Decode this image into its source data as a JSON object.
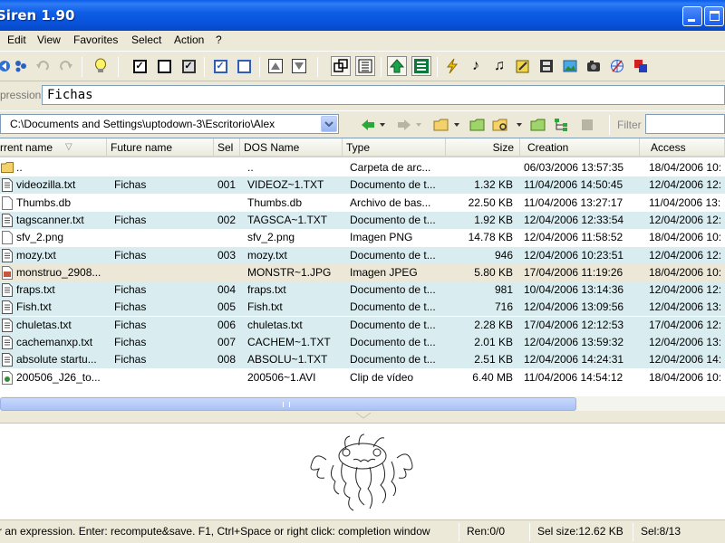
{
  "window": {
    "title": "Siren 1.90"
  },
  "menu": [
    "Edit",
    "View",
    "Favorites",
    "Select",
    "Action",
    "?"
  ],
  "toolbar": {
    "buttons": [
      "back-icon",
      "options-icon",
      "undo-icon",
      "redo-icon",
      "lightbulb-icon",
      "check-all-icon",
      "uncheck-all-icon",
      "invert-check-icon",
      "select-checked-icon",
      "deselect-icon",
      "move-up-icon",
      "move-down-icon",
      "recompute-icon",
      "text-view-icon",
      "apply-icon",
      "list-icon",
      "lightning-icon",
      "music-note-icon",
      "music-notes-icon",
      "edit-icon",
      "film-icon",
      "image-icon",
      "camera-icon",
      "globe-icon",
      "palette-icon"
    ]
  },
  "expression": {
    "label": "pression",
    "value": "Fichas"
  },
  "path": {
    "value": "C:\\Documents and Settings\\uptodown-3\\Escritorio\\Alex",
    "filter_label": "Filter",
    "filter_value": ""
  },
  "columns": {
    "current": "rrent name",
    "future": "Future name",
    "sel": "Sel",
    "dos": "DOS Name",
    "type": "Type",
    "size": "Size",
    "creation": "Creation",
    "access": "Access"
  },
  "rows": [
    {
      "icon": "folder-icon",
      "current": "..",
      "future": "",
      "sel": "",
      "dos": "..",
      "type": "Carpeta de arc...",
      "size": "",
      "creation": "06/03/2006 13:57:35",
      "access": "18/04/2006 10:",
      "tint": "none"
    },
    {
      "icon": "text-file-icon",
      "current": "videozilla.txt",
      "future": "Fichas",
      "sel": "001",
      "dos": "VIDEOZ~1.TXT",
      "type": "Documento de t...",
      "size": "1.32 KB",
      "creation": "11/04/2006 14:50:45",
      "access": "12/04/2006 12:",
      "tint": "blue"
    },
    {
      "icon": "blank-file-icon",
      "current": "Thumbs.db",
      "future": "",
      "sel": "",
      "dos": "Thumbs.db",
      "type": "Archivo de bas...",
      "size": "22.50 KB",
      "creation": "11/04/2006 13:27:17",
      "access": "11/04/2006 13:",
      "tint": "none"
    },
    {
      "icon": "text-file-icon",
      "current": "tagscanner.txt",
      "future": "Fichas",
      "sel": "002",
      "dos": "TAGSCA~1.TXT",
      "type": "Documento de t...",
      "size": "1.92 KB",
      "creation": "12/04/2006 12:33:54",
      "access": "12/04/2006 12:",
      "tint": "blue"
    },
    {
      "icon": "blank-file-icon",
      "current": "sfv_2.png",
      "future": "",
      "sel": "",
      "dos": "sfv_2.png",
      "type": "Imagen PNG",
      "size": "14.78 KB",
      "creation": "12/04/2006 11:58:52",
      "access": "18/04/2006 10:",
      "tint": "none"
    },
    {
      "icon": "text-file-icon",
      "current": "mozy.txt",
      "future": "Fichas",
      "sel": "003",
      "dos": "mozy.txt",
      "type": "Documento de t...",
      "size": "946",
      "creation": "12/04/2006 10:23:51",
      "access": "12/04/2006 12:",
      "tint": "blue"
    },
    {
      "icon": "image-file-icon",
      "current": "monstruo_2908...",
      "future": "",
      "sel": "",
      "dos": "MONSTR~1.JPG",
      "type": "Imagen JPEG",
      "size": "5.80 KB",
      "creation": "17/04/2006 11:19:26",
      "access": "18/04/2006 10:",
      "tint": "tan"
    },
    {
      "icon": "text-file-icon",
      "current": "fraps.txt",
      "future": "Fichas",
      "sel": "004",
      "dos": "fraps.txt",
      "type": "Documento de t...",
      "size": "981",
      "creation": "10/04/2006 13:14:36",
      "access": "12/04/2006 12:",
      "tint": "blue"
    },
    {
      "icon": "text-file-icon",
      "current": "Fish.txt",
      "future": "Fichas",
      "sel": "005",
      "dos": "Fish.txt",
      "type": "Documento de t...",
      "size": "716",
      "creation": "12/04/2006 13:09:56",
      "access": "12/04/2006 13:",
      "tint": "blue"
    },
    {
      "icon": "text-file-icon",
      "current": "chuletas.txt",
      "future": "Fichas",
      "sel": "006",
      "dos": "chuletas.txt",
      "type": "Documento de t...",
      "size": "2.28 KB",
      "creation": "17/04/2006 12:12:53",
      "access": "17/04/2006 12:",
      "tint": "blue"
    },
    {
      "icon": "text-file-icon",
      "current": "cachemanxp.txt",
      "future": "Fichas",
      "sel": "007",
      "dos": "CACHEM~1.TXT",
      "type": "Documento de t...",
      "size": "2.01 KB",
      "creation": "12/04/2006 13:59:32",
      "access": "12/04/2006 13:",
      "tint": "blue"
    },
    {
      "icon": "text-file-icon",
      "current": "absolute startu...",
      "future": "Fichas",
      "sel": "008",
      "dos": "ABSOLU~1.TXT",
      "type": "Documento de t...",
      "size": "2.51 KB",
      "creation": "12/04/2006 14:24:31",
      "access": "12/04/2006 14:",
      "tint": "blue"
    },
    {
      "icon": "video-file-icon",
      "current": "200506_J26_to...",
      "future": "",
      "sel": "",
      "dos": "200506~1.AVI",
      "type": "Clip de vídeo",
      "size": "6.40 MB",
      "creation": "11/04/2006 14:54:12",
      "access": "18/04/2006 10:",
      "tint": "none"
    }
  ],
  "status": {
    "hint": "r an expression. Enter: recompute&save. F1, Ctrl+Space or right click: completion window",
    "ren": "Ren:0/0",
    "sel_size": "Sel size:12.62 KB",
    "sel": "Sel:8/13"
  },
  "colors": {
    "title_blue": "#0851d8",
    "row_blue": "#d9edf1",
    "row_tan": "#ece7d6"
  }
}
